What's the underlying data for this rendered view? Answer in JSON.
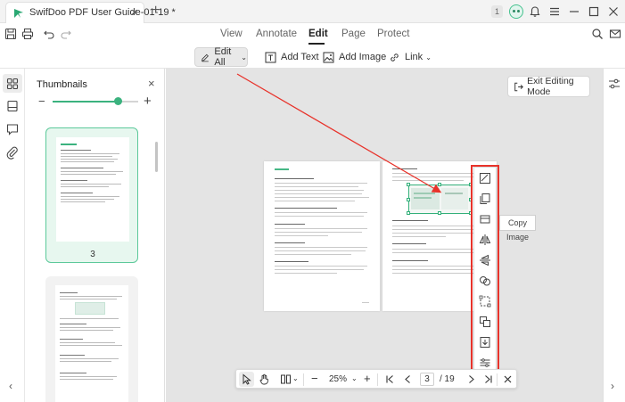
{
  "app": {
    "tab_title": "SwifDoo PDF User Guide-01-19 *",
    "tab_close": "×",
    "new_tab": "+",
    "notification_badge": "1"
  },
  "menu": {
    "tabs": [
      {
        "label": "View"
      },
      {
        "label": "Annotate"
      },
      {
        "label": "Edit"
      },
      {
        "label": "Page"
      },
      {
        "label": "Protect"
      }
    ],
    "active": "Edit"
  },
  "toolbar": {
    "edit_all": "Edit All",
    "add_text": "Add Text",
    "add_image": "Add Image",
    "link": "Link"
  },
  "thumbnails": {
    "title": "Thumbnails",
    "close": "×",
    "minus": "−",
    "plus": "+",
    "zoom_level": 0.77,
    "page_number": "3"
  },
  "canvas": {
    "exit_editing": "Exit Editing Mode",
    "tooltip": "Copy Image"
  },
  "bottom": {
    "zoom": "25%",
    "current_page": "3",
    "total_pages": "/ 19",
    "minus": "−",
    "plus": "+"
  },
  "colors": {
    "accent": "#3bb27e",
    "highlight": "#e8332b"
  }
}
